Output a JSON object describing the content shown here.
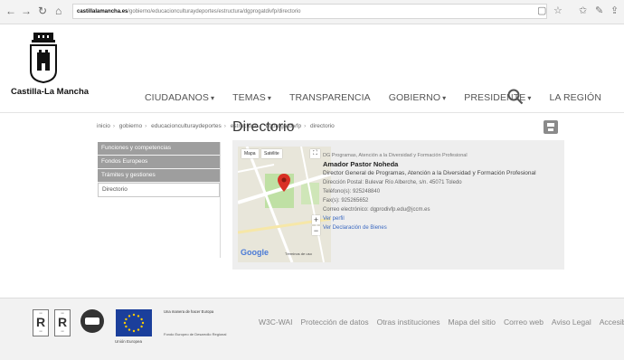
{
  "browser": {
    "url_host": "castillalamancha.es",
    "url_path": "/gobierno/educacionculturaydeportes/estructura/dgprogatdivfp/directorio"
  },
  "header": {
    "logo_text": "Castilla-La Mancha",
    "nav": [
      {
        "label": "CIUDADANOS",
        "dropdown": true
      },
      {
        "label": "TEMAS",
        "dropdown": true
      },
      {
        "label": "TRANSPARENCIA",
        "dropdown": false
      },
      {
        "label": "GOBIERNO",
        "dropdown": true
      },
      {
        "label": "PRESIDENTE",
        "dropdown": true
      },
      {
        "label": "LA REGIÓN",
        "dropdown": false
      }
    ],
    "caret": "▾"
  },
  "breadcrumb": [
    "inicio",
    "gobierno",
    "educacionculturaydeportes",
    "estructura",
    "dgprogatdivfp",
    "directorio"
  ],
  "sidebar": {
    "items": [
      {
        "label": "Funciones y competencias",
        "selected": false
      },
      {
        "label": "Fondos Europeos",
        "selected": false
      },
      {
        "label": "Trámites y gestiones",
        "selected": false
      },
      {
        "label": "Directorio",
        "selected": true
      }
    ]
  },
  "main": {
    "title": "Directorio",
    "map": {
      "mapa_label": "Mapa",
      "satelite_label": "Satélite",
      "zoom_in": "+",
      "zoom_out": "−",
      "google": "Google",
      "terms": "Términos de uso"
    },
    "contact": {
      "department": "DG Programas, Atención a la Diversidad y Formación Profesional",
      "name": "Amador Pastor Noheda",
      "role": "Director General de Programas, Atención a la Diversidad y Formación Profesional",
      "address": "Dirección Postal: Bulevar Río Alberche, s/n. 45071 Toledo",
      "phone": "Teléfono(s): 925248840",
      "fax": "Fax(s): 925265652",
      "email": "Correo electrónico: dgprodivfp.edu@jccm.es",
      "profile_link": "Ver perfil",
      "assets_link": "Ver Declaración de Bienes"
    }
  },
  "footer": {
    "eu_caption": "Unión Europea",
    "eu_text": "Una manera de hacer Europa",
    "eu_fund": "Fondo Europeo de Desarrollo Regional",
    "links": [
      "W3C-WAI",
      "Protección de datos",
      "Otras instituciones",
      "Mapa del sitio",
      "Correo web",
      "Aviso Legal",
      "Accesibilidad"
    ]
  },
  "colors": {
    "sidebar_bg": "#9e9e9e",
    "card_bg": "#eeeeee",
    "link": "#3b69c1",
    "map_pin": "#d93025"
  }
}
